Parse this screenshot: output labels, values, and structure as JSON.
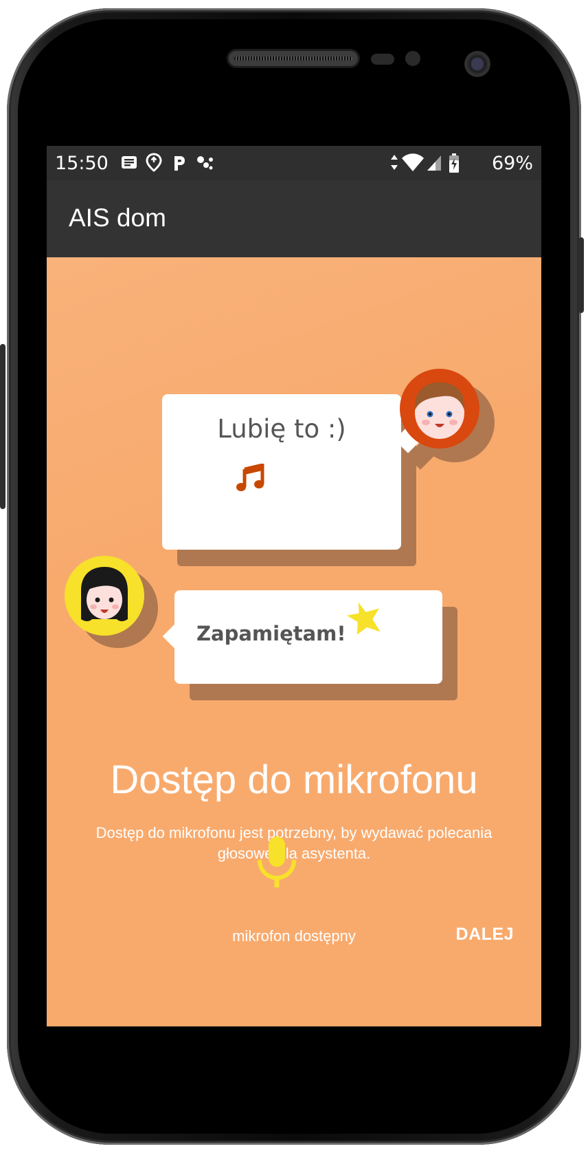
{
  "status_bar": {
    "time": "15:50",
    "battery": "69%",
    "icons": [
      "notes-icon",
      "location-pin-icon",
      "p-badge-icon",
      "dots-icon",
      "data-arrows-icon",
      "wifi-icon",
      "cell-signal-icon",
      "battery-charging-icon"
    ]
  },
  "app_bar": {
    "title": "AIS dom"
  },
  "illustration": {
    "bubble_top_text": "Lubię to :)",
    "bubble_bottom_text": "Zapamiętam!",
    "icons": [
      "music-note-icon",
      "boy-avatar-icon",
      "girl-avatar-icon",
      "star-icon"
    ]
  },
  "main": {
    "heading": "Dostęp do mikrofonu",
    "description": "Dostęp do mikrofonu jest potrzebny, by wydawać polecania głosowe dla asystenta.",
    "mic_status": "mikrofon dostępny",
    "next_label": "DALEJ"
  },
  "colors": {
    "background": "#f8aa6d",
    "status_bar": "#2f2f2f",
    "app_bar": "#333333",
    "accent_yellow": "#f7e12a",
    "note_color": "#c84800",
    "boy_ring": "#d9480f"
  }
}
